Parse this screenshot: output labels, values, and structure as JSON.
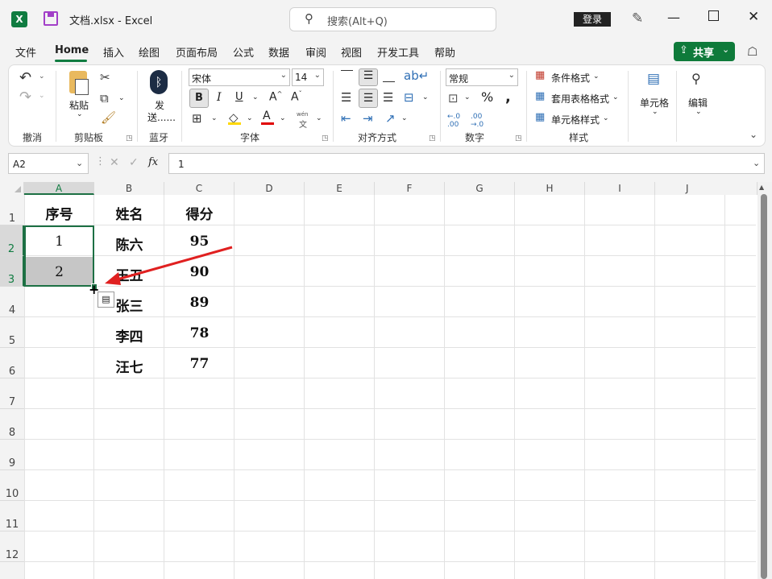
{
  "window": {
    "title": "文档.xlsx  -  Excel",
    "search_placeholder": "搜索(Alt+Q)",
    "login_label": "登录"
  },
  "tabs": [
    "文件",
    "Home",
    "插入",
    "绘图",
    "页面布局",
    "公式",
    "数据",
    "审阅",
    "视图",
    "开发工具",
    "帮助"
  ],
  "share_label": "共享",
  "ribbon": {
    "undo_group": "撤消",
    "paste_label": "粘贴",
    "clipboard_group": "剪贴板",
    "send_label_1": "发",
    "send_label_2": "送......",
    "bluetooth_group": "蓝牙",
    "font_name": "宋体",
    "font_size": "14",
    "font_group": "字体",
    "align_group": "对齐方式",
    "number_format": "常规",
    "number_group": "数字",
    "cond_format": "条件格式",
    "table_format": "套用表格格式",
    "cell_styles": "单元格样式",
    "styles_group": "样式",
    "cells_label": "单元格",
    "edit_label": "编辑",
    "wen": "wén",
    "wen_char": "文"
  },
  "formula_bar": {
    "name_box": "A2",
    "formula": "1"
  },
  "columns": [
    "A",
    "B",
    "C",
    "D",
    "E",
    "F",
    "G",
    "H",
    "I",
    "J"
  ],
  "rows": [
    "1",
    "2",
    "3",
    "4",
    "5",
    "6",
    "7",
    "8",
    "9",
    "10",
    "11",
    "12"
  ],
  "table": {
    "headers": [
      "序号",
      "姓名",
      "得分"
    ],
    "rows": [
      {
        "seq": "1",
        "name": "陈六",
        "score": "95"
      },
      {
        "seq": "2",
        "name": "王五",
        "score": "90"
      },
      {
        "seq": "",
        "name": "张三",
        "score": "89"
      },
      {
        "seq": "",
        "name": "李四",
        "score": "78"
      },
      {
        "seq": "",
        "name": "汪七",
        "score": "77"
      }
    ]
  },
  "colors": {
    "accent": "#107c41",
    "selection_border": "#1d7044",
    "arrow": "#e02020"
  }
}
